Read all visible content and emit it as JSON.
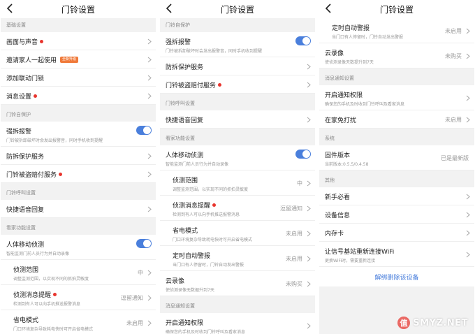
{
  "colors": {
    "accent": "#4a7fdc",
    "dot": "#e8352e",
    "badge": "#f07a3a"
  },
  "panel1": {
    "title": "门铃设置",
    "s_basic": "基础设置",
    "r_screen": "画面与声音",
    "r_invite": "邀请家人一起使用",
    "r_invite_badge": "全新升级",
    "r_lock": "添加联动门锁",
    "r_msg": "消息设置",
    "s_protect": "门铃自保护",
    "r_alarm": "强拆报警",
    "r_alarm_sub": "门铃被拆卸破坏时会发出报警音，同时手机收到提醒",
    "r_anti": "防拆保护服务",
    "r_theft": "门铃被盗赔付服务",
    "s_call": "门铃呼叫设置",
    "r_reply": "快捷语音回复",
    "s_care": "看家功能设置",
    "r_motion": "人体移动侦测",
    "r_motion_sub": "智能监测门前人员行为并自动录像",
    "r_range": "侦测范围",
    "r_range_sub": "调整监测范围，以实现不同的抓拍灵敏度",
    "r_range_val": "中",
    "r_remind": "侦测消息提醒",
    "r_remind_sub": "检测到有人可以向手机推送报警消息",
    "r_remind_val": "逗留通知",
    "r_power": "省电模式",
    "r_power_sub": "门口环境复杂导致耗电快时可开启省电模式",
    "r_power_val": "未启用"
  },
  "panel2": {
    "title": "门铃设置",
    "s_protect": "门铃自保护",
    "r_alarm": "强拆报警",
    "r_alarm_sub": "门铃被拆卸破坏时会发出报警音，同时手机收到提醒",
    "r_anti": "防拆保护服务",
    "r_theft": "门铃被盗赔付服务",
    "s_call": "门铃呼叫设置",
    "r_reply": "快捷语音回复",
    "s_care": "看家功能设置",
    "r_motion": "人体移动侦测",
    "r_motion_sub": "智能监测门前人员行为并自动录像",
    "r_range": "侦测范围",
    "r_range_sub": "调整监测范围，以实现不同的抓拍灵敏度",
    "r_range_val": "中",
    "r_remind": "侦测消息提醒",
    "r_remind_sub": "检测到有人可以向手机推送报警消息",
    "r_remind_val": "逗留通知",
    "r_power": "省电模式",
    "r_power_sub": "门口环境复杂导致耗电快时可开启省电模式",
    "r_power_val": "未启用",
    "r_timer": "定时自动警报",
    "r_timer_sub": "当门口有人停留时，门铃自动发出警报",
    "r_timer_val": "未启用",
    "r_cloud": "云录像",
    "r_cloud_sub": "使侦测录像无数据升到7天",
    "r_cloud_val": "未购买",
    "s_notify": "消息通知设置",
    "r_perm": "开启通知权限",
    "r_perm_sub": "确保您的手机及时收到门铃呼叫及看家消息"
  },
  "panel3": {
    "title": "门铃设置",
    "r_timer": "定时自动警报",
    "r_timer_sub": "当门口有人停留时，门铃自动发出警报",
    "r_timer_val": "未启用",
    "r_cloud": "云录像",
    "r_cloud_sub": "使侦测录像天数提升到7天",
    "r_cloud_val": "未购买",
    "s_notify": "消息通知设置",
    "r_perm": "开启通知权限",
    "r_perm_sub": "确保您的手机及时收到门铃呼叫及看家消息",
    "r_home": "在家免打扰",
    "r_home_val": "未启用",
    "s_system": "系统",
    "r_fw": "固件版本",
    "r_fw_sub": "当前版本:0.5.5/0.4.58",
    "r_fw_val": "已是最新版",
    "s_other": "其他",
    "r_guide": "新手必看",
    "r_info": "设备信息",
    "r_card": "内存卡",
    "r_wifi": "让信号基站重新连接WiFi",
    "r_wifi_sub": "更换WiFi时，需要重新连接",
    "unbind": "解绑删除该设备",
    "watermark": "SMYZ.NET"
  }
}
